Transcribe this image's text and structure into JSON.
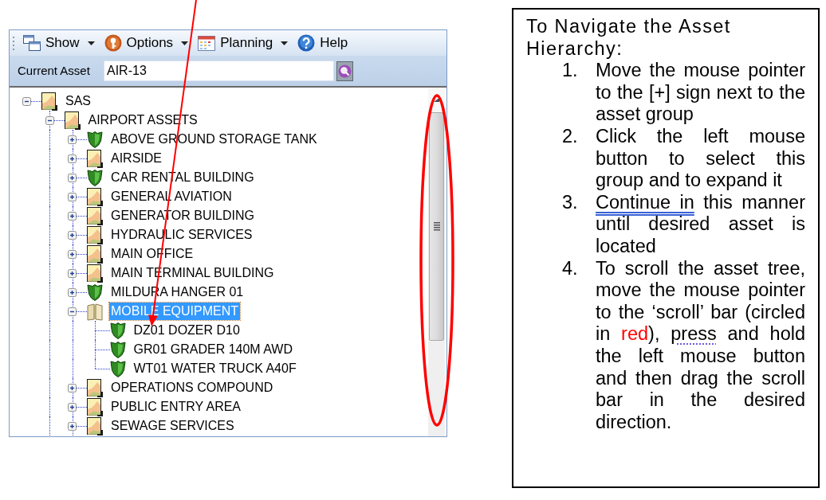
{
  "toolbar": {
    "items": [
      {
        "label": "Show",
        "kind": "dropdown"
      },
      {
        "label": "Options",
        "kind": "dropdown"
      },
      {
        "label": "Planning",
        "kind": "dropdown"
      },
      {
        "label": "Help",
        "kind": "button"
      }
    ]
  },
  "current_asset": {
    "label": "Current Asset",
    "value": "AIR-13"
  },
  "asset_tree": {
    "items": [
      {
        "label": "SAS",
        "kind": "group",
        "expanded": true,
        "selected": false,
        "children": [
          {
            "label": "AIRPORT ASSETS",
            "kind": "group",
            "expanded": true,
            "selected": false,
            "children": [
              {
                "label": "ABOVE GROUND STORAGE TANK",
                "kind": "asset",
                "expanded": false,
                "selected": false
              },
              {
                "label": "AIRSIDE",
                "kind": "group",
                "expanded": false,
                "selected": false
              },
              {
                "label": "CAR RENTAL BUILDING",
                "kind": "asset",
                "expanded": false,
                "selected": false
              },
              {
                "label": "GENERAL AVIATION",
                "kind": "group",
                "expanded": false,
                "selected": false
              },
              {
                "label": "GENERATOR BUILDING",
                "kind": "group",
                "expanded": false,
                "selected": false
              },
              {
                "label": "HYDRAULIC SERVICES",
                "kind": "group",
                "expanded": false,
                "selected": false
              },
              {
                "label": "MAIN OFFICE",
                "kind": "group",
                "expanded": false,
                "selected": false
              },
              {
                "label": "MAIN TERMINAL BUILDING",
                "kind": "group",
                "expanded": false,
                "selected": false
              },
              {
                "label": "MILDURA HANGER 01",
                "kind": "asset",
                "expanded": false,
                "selected": false
              },
              {
                "label": "MOBILE EQUIPMENT",
                "kind": "group",
                "expanded": true,
                "selected": true,
                "children": [
                  {
                    "label": "DZ01 DOZER D10",
                    "kind": "asset",
                    "selected": false
                  },
                  {
                    "label": "GR01 GRADER 140M AWD",
                    "kind": "asset",
                    "selected": false
                  },
                  {
                    "label": "WT01 WATER TRUCK A40F",
                    "kind": "asset",
                    "selected": false
                  }
                ]
              },
              {
                "label": "OPERATIONS COMPOUND",
                "kind": "group",
                "expanded": false,
                "selected": false
              },
              {
                "label": "PUBLIC ENTRY AREA",
                "kind": "group",
                "expanded": false,
                "selected": false
              },
              {
                "label": "SEWAGE SERVICES",
                "kind": "group",
                "expanded": false,
                "selected": false
              }
            ]
          }
        ]
      }
    ]
  },
  "instructions": {
    "title": "To Navigate the Asset Hierarchy:",
    "steps": [
      {
        "number": "1.",
        "segments": [
          {
            "kind": "plain",
            "text": "Move the mouse pointer to the [+] sign next to the asset group"
          }
        ]
      },
      {
        "number": "2.",
        "segments": [
          {
            "kind": "plain",
            "text": "Click the left mouse button to select this group and to expand it"
          }
        ]
      },
      {
        "number": "3.",
        "segments": [
          {
            "kind": "grammar-mark",
            "text": "Continue in"
          },
          {
            "kind": "plain",
            "text": " this manner until desired asset is located"
          }
        ]
      },
      {
        "number": "4.",
        "segments": [
          {
            "kind": "plain",
            "text": "To scroll the asset tree, move the mouse pointer to the ‘scroll’ bar (circled in "
          },
          {
            "kind": "colored",
            "color": "#ff0000",
            "text": "red"
          },
          {
            "kind": "plain",
            "text": "), "
          },
          {
            "kind": "spelling-mark",
            "text": "press"
          },
          {
            "kind": "plain",
            "text": " and hold the left mouse button and then drag the scroll bar in the desired direction."
          }
        ]
      }
    ]
  }
}
